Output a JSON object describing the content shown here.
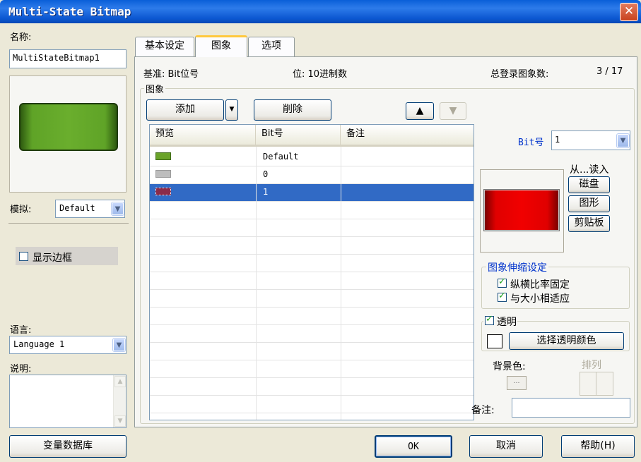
{
  "window": {
    "title": "Multi-State Bitmap",
    "close_glyph": "✕"
  },
  "left": {
    "name_label": "名称:",
    "name_value": "MultiStateBitmap1",
    "simulate_label": "模拟:",
    "simulate_value": "Default",
    "show_border_label": "显示边框",
    "language_label": "语言:",
    "language_value": "Language 1",
    "description_label": "说明:",
    "var_db_button": "变量数据库"
  },
  "tabs": [
    {
      "label": "基本设定"
    },
    {
      "label": "图象"
    },
    {
      "label": "选项"
    }
  ],
  "panel": {
    "base_label": "基准: Bit位号",
    "bit_label": "位: 10进制数",
    "total_label": "总登录图象数:",
    "total_value": "3 / 17",
    "group_label": "图象",
    "add_button": "添加",
    "delete_button": "削除",
    "columns": [
      "预览",
      "Bit号",
      "备注"
    ],
    "rows": [
      {
        "bit": "Default",
        "note": "",
        "swatch": "#6AA329"
      },
      {
        "bit": "0",
        "note": "",
        "swatch": "#BDBDBD"
      },
      {
        "bit": "1",
        "note": "",
        "swatch": "#8A2B4A"
      }
    ],
    "bit_no_label": "Bit号",
    "bit_no_value": "1",
    "read_from_label": "从...读入",
    "disk_button": "磁盘",
    "shape_button": "图形",
    "clipboard_button": "剪贴板",
    "stretch_group": "图象伸缩设定",
    "keep_ratio_label": "纵横比率固定",
    "fit_size_label": "与大小相适应",
    "transparent_label": "透明",
    "select_transparent_button": "选择透明颜色",
    "bg_color_label": "背景色:",
    "arrange_label": "排列",
    "note_label": "备注:"
  },
  "footer": {
    "ok": "OK",
    "cancel": "取消",
    "help": "帮助(H)"
  },
  "colors": {
    "selection": "#316AC5",
    "titlebar": "#0A5FD8",
    "preview_green": "#6AA329",
    "preview_red": "#E00000"
  }
}
